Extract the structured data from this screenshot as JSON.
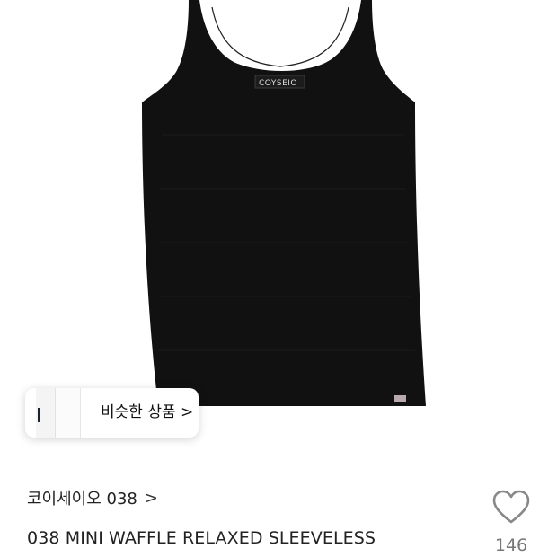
{
  "product_image": {
    "garment_label": "COYSEIO"
  },
  "similar_products": {
    "label": "비슷한 상품 >"
  },
  "brand": {
    "name": "코이세이오 038",
    "chevron": ">"
  },
  "product": {
    "name": "038 MINI WAFFLE RELAXED SLEEVELESS"
  },
  "like": {
    "icon": "heart-outline-icon",
    "count": "146"
  },
  "colors": {
    "garment": "#111111",
    "background": "#ffffff"
  }
}
